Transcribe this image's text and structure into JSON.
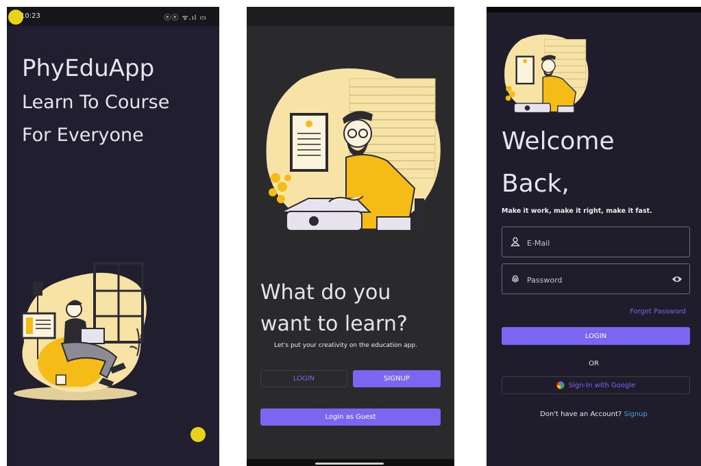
{
  "screen1": {
    "status_time": "10:23",
    "status_icons": "ⓔⓔ ᯤ.ıl ▭",
    "title": "PhyEduApp",
    "tagline_line1": "Learn To Course",
    "tagline_line2": "For Everyone"
  },
  "screen2": {
    "heading_line1": "What do you",
    "heading_line2": "want to learn?",
    "subtitle": "Let's put your creativity on the education app.",
    "login_label": "LOGIN",
    "signup_label": "SIGNUP",
    "guest_label": "Login as Guest"
  },
  "screen3": {
    "heading_line1": "Welcome",
    "heading_line2": "Back,",
    "subtitle": "Make it work, make it right, make it fast.",
    "email_placeholder": "E-Mail",
    "password_placeholder": "Password",
    "forget_password": "Forget Password",
    "login_label": "LOGIN",
    "or_label": "OR",
    "google_label": "Sign-In with Google",
    "no_account": "Don't have an Account?",
    "signup_link": "Signup"
  },
  "colors": {
    "accent": "#7b66f2",
    "illustration_yellow": "#f7e3a6",
    "shirt_yellow": "#f5bb16",
    "dot_yellow": "#f2dd1a"
  }
}
